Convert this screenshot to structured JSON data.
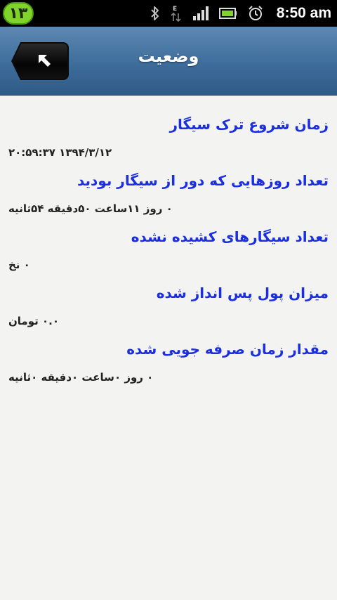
{
  "status_bar": {
    "notification_count": "۱۳",
    "time": "8:50 am",
    "icons": [
      "bluetooth-icon",
      "data-transfer-icon",
      "signal-icon",
      "battery-icon",
      "alarm-icon"
    ]
  },
  "header": {
    "title": "وضعیت",
    "back_icon": "back-arrow-icon"
  },
  "items": [
    {
      "label": "زمان شروع ترک سیگار",
      "value": "۱۳۹۴/۳/۱۲ ۲۰:۵۹:۳۷"
    },
    {
      "label": "تعداد روزهایی که دور از سیگار بودید",
      "value": "۰ روز ۱۱ساعت ۵۰دقیقه ۵۴ثانیه"
    },
    {
      "label": "تعداد سیگارهای کشیده نشده",
      "value": "۰ نخ"
    },
    {
      "label": "میزان پول پس انداز شده",
      "value": "۰.۰ تومان"
    },
    {
      "label": "مقدار زمان صرفه جویی شده",
      "value": "۰ روز ۰ساعت ۰دقیقه ۰ثانیه"
    }
  ],
  "colors": {
    "label": "#1a2fe0",
    "value": "#222222",
    "header_top": "#5d89b3",
    "header_bottom": "#2f5a87",
    "badge": "#7fd32a"
  }
}
